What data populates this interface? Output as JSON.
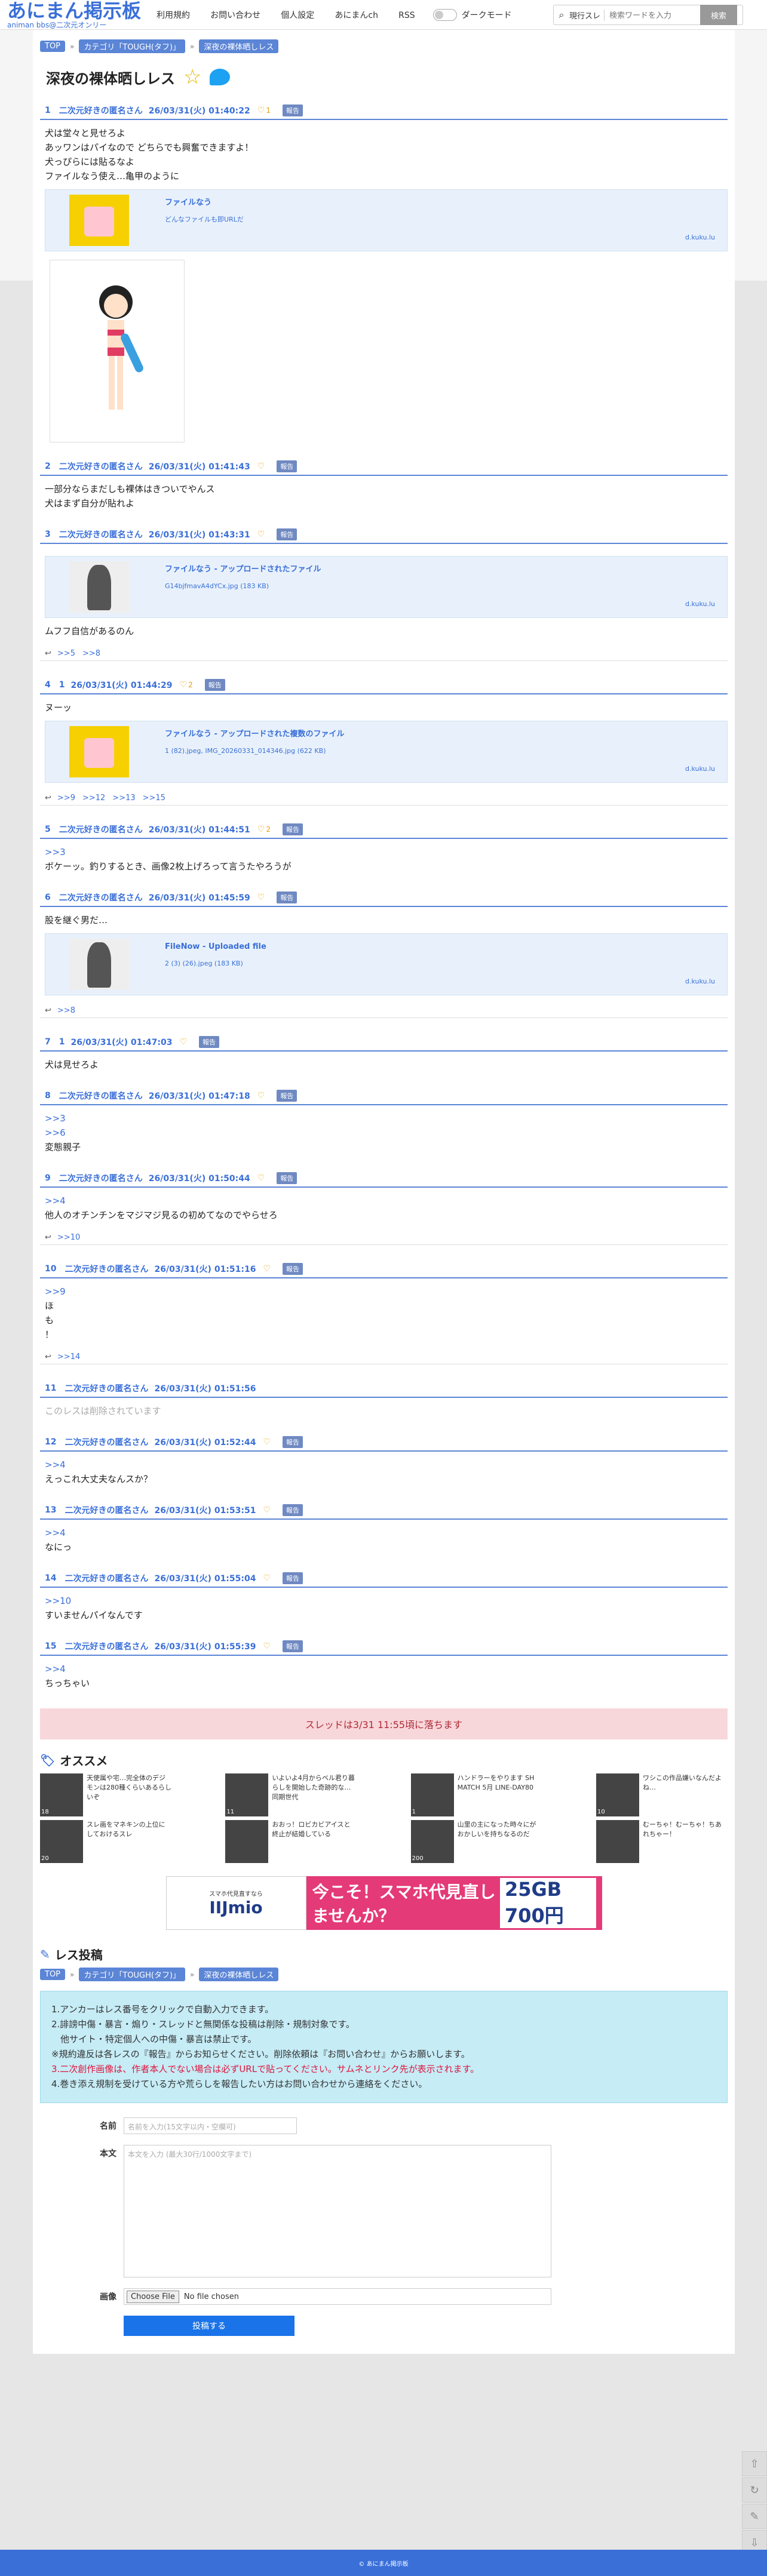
{
  "header": {
    "logo": "あにまん掲示板",
    "logo_sub": "animan bbs@二次元オンリー",
    "nav": [
      "利用規約",
      "お問い合わせ",
      "個人設定",
      "あにまんch",
      "RSS"
    ],
    "dark_mode": "ダークモード",
    "search_scope": "現行スレ",
    "search_placeholder": "検索ワードを入力",
    "search_button": "検索"
  },
  "breadcrumb": [
    "TOP",
    "カテゴリ「TOUGH(タフ)」",
    "深夜の裸体晒しレス"
  ],
  "thread_title": "深夜の裸体晒しレス",
  "posts": [
    {
      "num": "1",
      "name": "二次元好きの匿名さん",
      "date": "26/03/31(火) 01:40:22",
      "hearts": "1",
      "report": "報告",
      "lines": [
        "犬は堂々と見せろよ",
        "あッワンはパイなので どちらでも興奮できますよ！",
        "犬っぴらには貼るなよ",
        "ファイルなう使え…亀甲のように"
      ],
      "card": {
        "title": "ファイルなう",
        "desc": "どんなファイルも即URLだ",
        "domain": "d.kuku.lu"
      }
    },
    {
      "num": "2",
      "name": "二次元好きの匿名さん",
      "date": "26/03/31(火) 01:41:43",
      "report": "報告",
      "lines": [
        "一部分ならまだしも裸体はきついでやんス",
        "犬はまず自分が貼れよ"
      ]
    },
    {
      "num": "3",
      "name": "二次元好きの匿名さん",
      "date": "26/03/31(火) 01:43:31",
      "report": "報告",
      "card": {
        "title": "ファイルなう - アップロードされたファイル",
        "desc": "G14bjfmavA4dYCx.jpg (183 KB)",
        "domain": "d.kuku.lu"
      },
      "lines": [
        "ムフフ自信があるのん"
      ],
      "replies": [
        ">>5",
        ">>8"
      ]
    },
    {
      "num": "4",
      "name": "1",
      "date": "26/03/31(火) 01:44:29",
      "hearts": "2",
      "report": "報告",
      "lines": [
        "ヌーッ"
      ],
      "card": {
        "title": "ファイルなう - アップロードされた複数のファイル",
        "desc": "1 (82).jpeg, IMG_20260331_014346.jpg (622 KB)",
        "domain": "d.kuku.lu"
      },
      "replies": [
        ">>9",
        ">>12",
        ">>13",
        ">>15"
      ]
    },
    {
      "num": "5",
      "name": "二次元好きの匿名さん",
      "date": "26/03/31(火) 01:44:51",
      "hearts": "2",
      "report": "報告",
      "anchors": [
        ">>3"
      ],
      "lines": [
        "ボケーッ。釣りするとき、画像2枚上げろって言うたやろうが"
      ]
    },
    {
      "num": "6",
      "name": "二次元好きの匿名さん",
      "date": "26/03/31(火) 01:45:59",
      "report": "報告",
      "lines": [
        "股を継ぐ男だ…"
      ],
      "card": {
        "title": "FileNow - Uploaded file",
        "desc": "2 (3) (26).jpeg (183 KB)",
        "domain": "d.kuku.lu"
      },
      "replies": [
        ">>8"
      ]
    },
    {
      "num": "7",
      "name": "1",
      "date": "26/03/31(火) 01:47:03",
      "report": "報告",
      "lines": [
        "犬は見せろよ"
      ]
    },
    {
      "num": "8",
      "name": "二次元好きの匿名さん",
      "date": "26/03/31(火) 01:47:18",
      "report": "報告",
      "anchors": [
        ">>3",
        ">>6"
      ],
      "lines": [
        "変態親子"
      ]
    },
    {
      "num": "9",
      "name": "二次元好きの匿名さん",
      "date": "26/03/31(火) 01:50:44",
      "report": "報告",
      "anchors": [
        ">>4"
      ],
      "lines": [
        "他人のオチンチンをマジマジ見るの初めてなのでやらせろ"
      ],
      "replies": [
        ">>10"
      ]
    },
    {
      "num": "10",
      "name": "二次元好きの匿名さん",
      "date": "26/03/31(火) 01:51:16",
      "report": "報告",
      "anchors": [
        ">>9"
      ],
      "lines": [
        "ほ",
        "も",
        "！"
      ],
      "replies": [
        ">>14"
      ]
    },
    {
      "num": "11",
      "name": "二次元好きの匿名さん",
      "date": "26/03/31(火) 01:51:56",
      "deleted": "このレスは削除されています"
    },
    {
      "num": "12",
      "name": "二次元好きの匿名さん",
      "date": "26/03/31(火) 01:52:44",
      "report": "報告",
      "anchors": [
        ">>4"
      ],
      "lines": [
        "えっこれ大丈夫なんスか？"
      ]
    },
    {
      "num": "13",
      "name": "二次元好きの匿名さん",
      "date": "26/03/31(火) 01:53:51",
      "report": "報告",
      "anchors": [
        ">>4"
      ],
      "lines": [
        "なにっ"
      ]
    },
    {
      "num": "14",
      "name": "二次元好きの匿名さん",
      "date": "26/03/31(火) 01:55:04",
      "report": "報告",
      "anchors": [
        ">>10"
      ],
      "lines": [
        "すいませんパイなんです"
      ]
    },
    {
      "num": "15",
      "name": "二次元好きの匿名さん",
      "date": "26/03/31(火) 01:55:39",
      "report": "報告",
      "anchors": [
        ">>4"
      ],
      "lines": [
        "ちっちゃい"
      ]
    }
  ],
  "closed_notice": "スレッドは3/31 11:55頃に落ちます",
  "recommend": {
    "title": "オススメ",
    "items": [
      {
        "count": "18",
        "text": "天使属や宅…完全体のデジモンは280種くらいあるらしいぞ"
      },
      {
        "count": "20",
        "text": "スレ画をマネキンの上位にしておけるスレ"
      },
      {
        "count": "11",
        "text": "いよいよ4月からベル君り暮らしを開始した奇跡的な…同期世代"
      },
      {
        "count": "",
        "text": "おおっ！ロビカビアイスと終止が結婚している"
      },
      {
        "count": "1",
        "text": "ハンドラーをやります SH MATCH 5月 LINE-DAY80"
      },
      {
        "count": "200",
        "text": "山里の主になった時々にがおかしいを持ちなるのだ"
      },
      {
        "count": "10",
        "text": "ワシこの作品嫌いなんだよね…"
      },
      {
        "count": "",
        "text": "むーちゃ！むーちゃ！ちあれちゃー！"
      }
    ]
  },
  "ad": {
    "left_small": "スマホ代見直すなら",
    "left_brand": "IIJmio",
    "headline": "今こそ！スマホ代見直しませんか？",
    "price": "25GB 700円"
  },
  "post_form": {
    "title": "レス投稿",
    "notice": [
      {
        "text": "1.アンカーはレス番号をクリックで自動入力できます。",
        "red": false
      },
      {
        "text": "2.誹謗中傷・暴言・煽り・スレッドと無関係な投稿は削除・規制対象です。",
        "red": false
      },
      {
        "text": "　他サイト・特定個人への中傷・暴言は禁止です。",
        "red": false
      },
      {
        "text": "※規約違反は各レスの『報告』からお知らせください。削除依頼は『お問い合わせ』からお願いします。",
        "red": false
      },
      {
        "text": "3.二次創作画像は、作者本人でない場合は必ずURLで貼ってください。サムネとリンク先が表示されます。",
        "red": true
      },
      {
        "text": "4.巻き添え規制を受けている方や荒らしを報告したい方はお問い合わせから連絡をください。",
        "red": false
      }
    ],
    "name_label": "名前",
    "name_placeholder": "名前を入力(15文字以内・空欄可)",
    "body_label": "本文",
    "body_placeholder": "本文を入力 (最大30行/1000文字まで)",
    "image_label": "画像",
    "file_button": "Choose File",
    "file_status": "No file chosen",
    "submit": "投稿する"
  },
  "footer": "© あにまん掲示板"
}
